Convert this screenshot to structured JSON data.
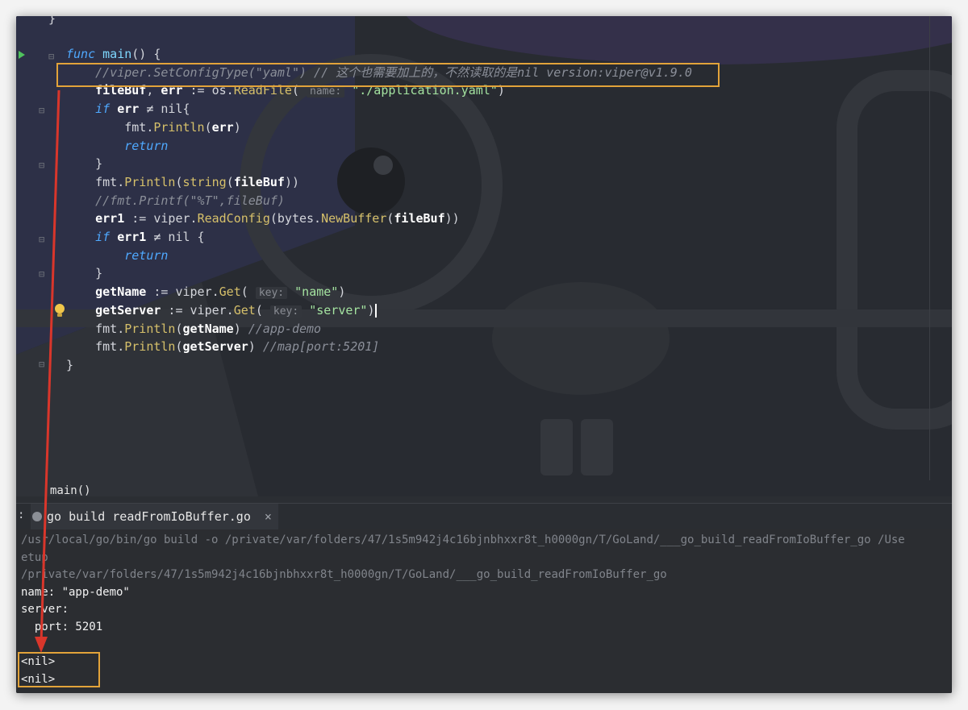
{
  "editor": {
    "top_brace": "}",
    "lines": [
      {
        "parts": [
          {
            "t": "func ",
            "c": "kw"
          },
          {
            "t": "main",
            "c": "fn"
          },
          {
            "t": "() {",
            "c": ""
          }
        ]
      },
      {
        "indent": "    ",
        "parts": [
          {
            "t": "//viper.SetConfigType(\"yaml\") // 这个也需要加上的，不然读取的是nil version:viper@v1.9.0",
            "c": "cm"
          }
        ]
      },
      {
        "indent": "    ",
        "parts": [
          {
            "t": "fileBuf",
            "c": "bold"
          },
          {
            "t": ", ",
            "c": ""
          },
          {
            "t": "err",
            "c": "bold"
          },
          {
            "t": " := os.",
            "c": ""
          },
          {
            "t": "ReadFile",
            "c": "call"
          },
          {
            "t": "( ",
            "c": ""
          },
          {
            "t": "name:",
            "c": "hint"
          },
          {
            "t": " \"./application.yaml\"",
            "c": "str"
          },
          {
            "t": ")",
            "c": ""
          }
        ]
      },
      {
        "indent": "    ",
        "parts": [
          {
            "t": "if ",
            "c": "kw"
          },
          {
            "t": "err",
            "c": "bold"
          },
          {
            "t": " ≠ nil{",
            "c": ""
          }
        ]
      },
      {
        "indent": "        ",
        "parts": [
          {
            "t": "fmt.",
            "c": ""
          },
          {
            "t": "Println",
            "c": "call"
          },
          {
            "t": "(",
            "c": ""
          },
          {
            "t": "err",
            "c": "bold"
          },
          {
            "t": ")",
            "c": ""
          }
        ]
      },
      {
        "indent": "        ",
        "parts": [
          {
            "t": "return",
            "c": "kw"
          }
        ]
      },
      {
        "indent": "    ",
        "parts": [
          {
            "t": "}",
            "c": ""
          }
        ]
      },
      {
        "indent": "    ",
        "parts": [
          {
            "t": "fmt.",
            "c": ""
          },
          {
            "t": "Println",
            "c": "call"
          },
          {
            "t": "(",
            "c": ""
          },
          {
            "t": "string",
            "c": "call"
          },
          {
            "t": "(",
            "c": ""
          },
          {
            "t": "fileBuf",
            "c": "bold"
          },
          {
            "t": "))",
            "c": ""
          }
        ]
      },
      {
        "indent": "    ",
        "parts": [
          {
            "t": "//fmt.Printf(\"%T\",fileBuf)",
            "c": "cm"
          }
        ]
      },
      {
        "indent": "    ",
        "parts": [
          {
            "t": "err1",
            "c": "bold"
          },
          {
            "t": " := viper.",
            "c": ""
          },
          {
            "t": "ReadConfig",
            "c": "call"
          },
          {
            "t": "(bytes.",
            "c": ""
          },
          {
            "t": "NewBuffer",
            "c": "call"
          },
          {
            "t": "(",
            "c": ""
          },
          {
            "t": "fileBuf",
            "c": "bold"
          },
          {
            "t": "))",
            "c": ""
          }
        ]
      },
      {
        "indent": "    ",
        "parts": [
          {
            "t": "if ",
            "c": "kw"
          },
          {
            "t": "err1",
            "c": "bold"
          },
          {
            "t": " ≠ nil {",
            "c": ""
          }
        ]
      },
      {
        "indent": "        ",
        "parts": [
          {
            "t": "return",
            "c": "kw"
          }
        ]
      },
      {
        "indent": "    ",
        "parts": [
          {
            "t": "}",
            "c": ""
          }
        ]
      },
      {
        "indent": "    ",
        "parts": [
          {
            "t": "getName",
            "c": "bold"
          },
          {
            "t": " := viper.",
            "c": ""
          },
          {
            "t": "Get",
            "c": "call"
          },
          {
            "t": "( ",
            "c": ""
          },
          {
            "t": "key:",
            "c": "hint"
          },
          {
            "t": " \"name\"",
            "c": "str"
          },
          {
            "t": ")",
            "c": ""
          }
        ]
      },
      {
        "indent": "    ",
        "parts": [
          {
            "t": "getServer",
            "c": "bold"
          },
          {
            "t": " := viper.",
            "c": ""
          },
          {
            "t": "Get",
            "c": "call"
          },
          {
            "t": "( ",
            "c": ""
          },
          {
            "t": "key:",
            "c": "hint"
          },
          {
            "t": " \"server\"",
            "c": "str"
          },
          {
            "t": ")",
            "c": ""
          }
        ],
        "cursor": true
      },
      {
        "indent": "    ",
        "parts": [
          {
            "t": "fmt.",
            "c": ""
          },
          {
            "t": "Println",
            "c": "call"
          },
          {
            "t": "(",
            "c": ""
          },
          {
            "t": "getName",
            "c": "bold"
          },
          {
            "t": ") ",
            "c": ""
          },
          {
            "t": "//app-demo",
            "c": "cm"
          }
        ]
      },
      {
        "indent": "    ",
        "parts": [
          {
            "t": "fmt.",
            "c": ""
          },
          {
            "t": "Println",
            "c": "call"
          },
          {
            "t": "(",
            "c": ""
          },
          {
            "t": "getServer",
            "c": "bold"
          },
          {
            "t": ") ",
            "c": ""
          },
          {
            "t": "//map[port:5201]",
            "c": "cm"
          }
        ]
      },
      {
        "indent": "",
        "parts": [
          {
            "t": "}",
            "c": ""
          }
        ]
      }
    ]
  },
  "breadcrumb": "main()",
  "run_panel": {
    "colon": ":",
    "tab_label": "go build readFromIoBuffer.go",
    "tab_close": "×"
  },
  "console": {
    "lines": [
      {
        "text": "/usr/local/go/bin/go build -o /private/var/folders/47/1s5m942j4c16bjnbhxxr8t_h0000gn/T/GoLand/___go_build_readFromIoBuffer_go /Use",
        "style": "grey"
      },
      {
        "text": "etup",
        "style": "grey"
      },
      {
        "text": "/private/var/folders/47/1s5m942j4c16bjnbhxxr8t_h0000gn/T/GoLand/___go_build_readFromIoBuffer_go",
        "style": "grey"
      },
      {
        "text": "name: \"app-demo\"",
        "style": "white"
      },
      {
        "text": "server:",
        "style": "white"
      },
      {
        "text": "  port: 5201",
        "style": "white"
      },
      {
        "text": "",
        "style": "white"
      },
      {
        "text": "<nil>",
        "style": "white"
      },
      {
        "text": "<nil>",
        "style": "white"
      }
    ]
  },
  "colors": {
    "highlight": "#e2a33a",
    "arrow": "#d9362b",
    "accent": "#4fa9ff"
  }
}
